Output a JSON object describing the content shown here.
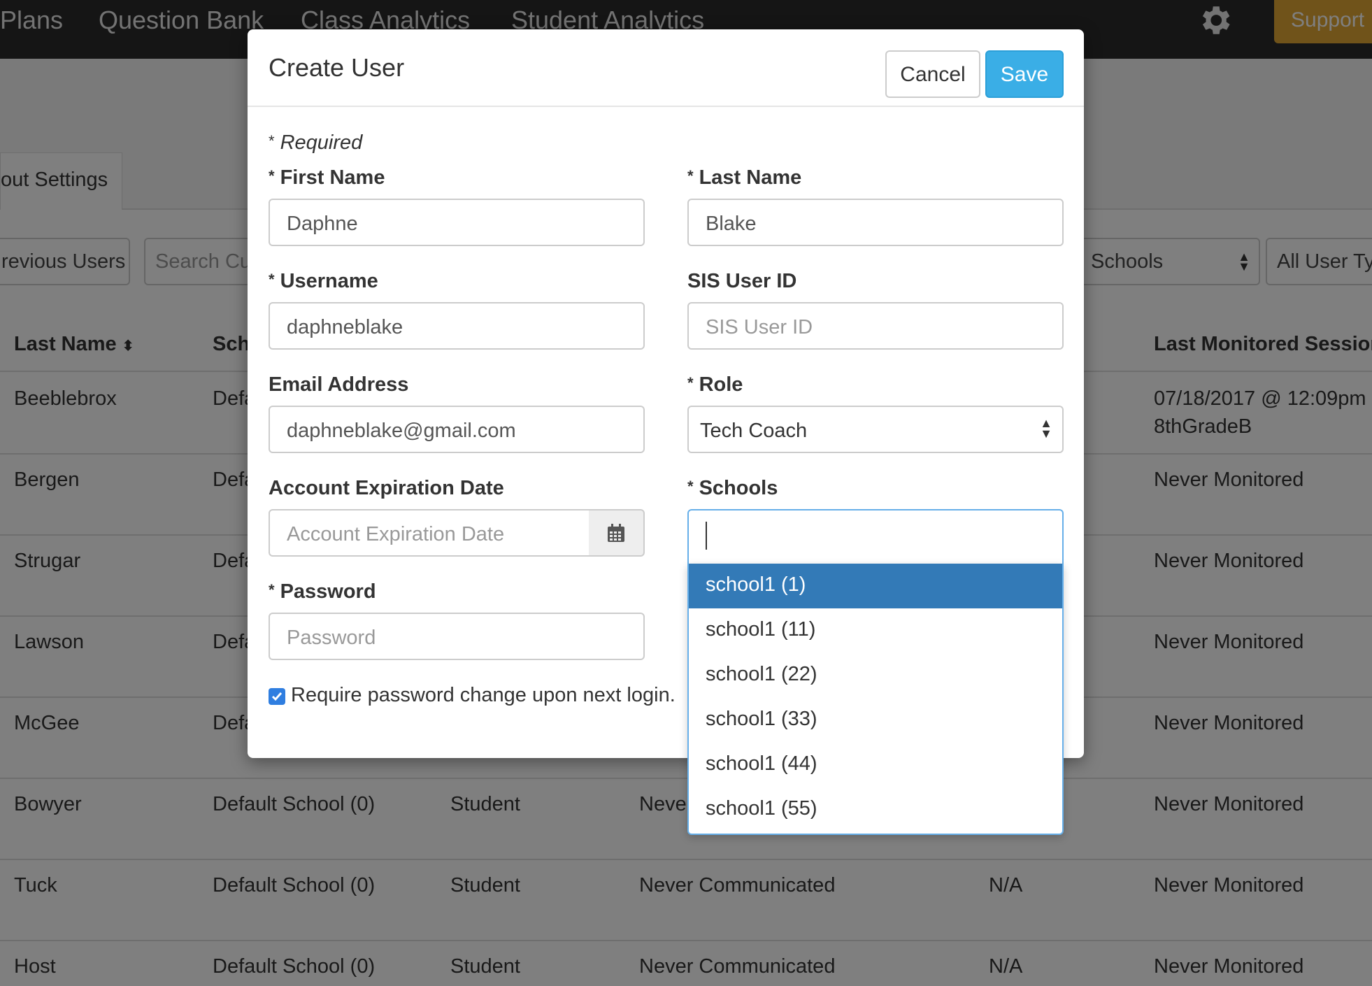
{
  "nav": {
    "items": [
      "Plans",
      "Question Bank",
      "Class Analytics",
      "Student Analytics"
    ],
    "support_label": "Support"
  },
  "page": {
    "settings_tab": "out Settings",
    "filters": {
      "previous_users": "revious Users",
      "search_placeholder": "Search Cu",
      "schools": "Schools",
      "user_types": "All User Typ"
    },
    "table": {
      "headers": [
        "Last Name",
        "Sch",
        "Last Monitored Session"
      ],
      "rows": [
        {
          "last_name": "Beeblebrox",
          "school": "Defa",
          "type": "",
          "comm": "",
          "na": "",
          "monitored": "07/18/2017 @ 12:09pm",
          "monitored2": "8thGradeB"
        },
        {
          "last_name": "Bergen",
          "school": "Defa",
          "type": "",
          "comm": "",
          "na": "",
          "monitored": "Never Monitored",
          "monitored2": ""
        },
        {
          "last_name": "Strugar",
          "school": "Defa",
          "type": "",
          "comm": "",
          "na": "",
          "monitored": "Never Monitored",
          "monitored2": ""
        },
        {
          "last_name": "Lawson",
          "school": "Defa",
          "type": "",
          "comm": "",
          "na": "",
          "monitored": "Never Monitored",
          "monitored2": ""
        },
        {
          "last_name": "McGee",
          "school": "Defa",
          "type": "",
          "comm": "",
          "na": "",
          "monitored": "Never Monitored",
          "monitored2": ""
        },
        {
          "last_name": "Bowyer",
          "school": "Default School (0)",
          "type": "Student",
          "comm": "Never",
          "na": "",
          "monitored": "Never Monitored",
          "monitored2": ""
        },
        {
          "last_name": "Tuck",
          "school": "Default School (0)",
          "type": "Student",
          "comm": "Never Communicated",
          "na": "N/A",
          "monitored": "Never Monitored",
          "monitored2": ""
        },
        {
          "last_name": "Host",
          "school": "Default School (0)",
          "type": "Student",
          "comm": "Never Communicated",
          "na": "N/A",
          "monitored": "Never Monitored",
          "monitored2": ""
        }
      ]
    }
  },
  "modal": {
    "title": "Create User",
    "cancel_label": "Cancel",
    "save_label": "Save",
    "required_note": "Required",
    "first_name": {
      "label": "First Name",
      "value": "Daphne"
    },
    "last_name": {
      "label": "Last Name",
      "value": "Blake"
    },
    "username": {
      "label": "Username",
      "value": "daphneblake"
    },
    "sis_user_id": {
      "label": "SIS User ID",
      "placeholder": "SIS User ID"
    },
    "email": {
      "label": "Email Address",
      "value": "daphneblake@gmail.com"
    },
    "role": {
      "label": "Role",
      "value": "Tech Coach"
    },
    "expiration": {
      "label": "Account Expiration Date",
      "placeholder": "Account Expiration Date"
    },
    "schools": {
      "label": "Schools",
      "options": [
        "school1 (1)",
        "school1 (11)",
        "school1 (22)",
        "school1 (33)",
        "school1 (44)",
        "school1 (55)"
      ],
      "highlighted": "school1 (1)"
    },
    "password": {
      "label": "Password",
      "placeholder": "Password"
    },
    "require_change": {
      "label": "Require password change upon next login.",
      "checked": true
    }
  }
}
